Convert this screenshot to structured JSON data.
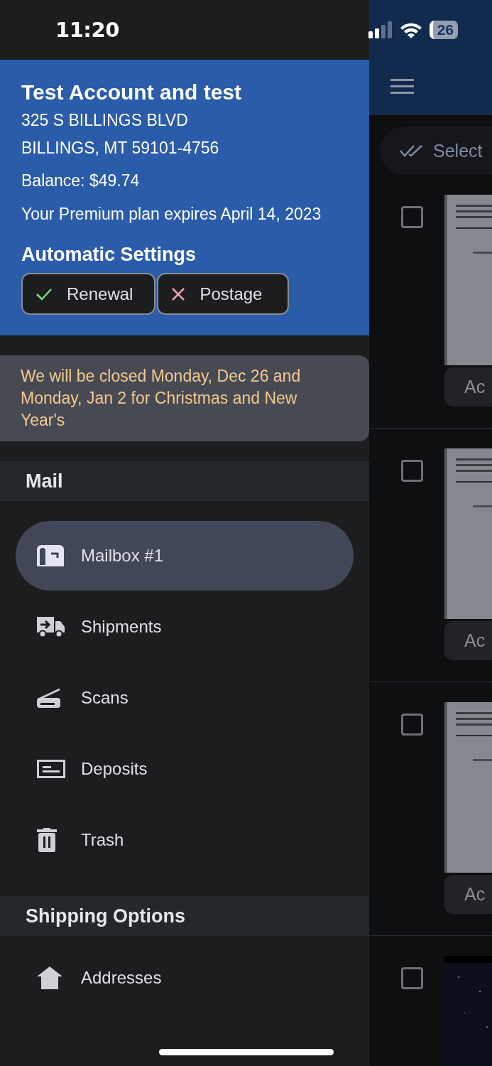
{
  "status_bar": {
    "time": "11:20",
    "battery": "26"
  },
  "drawer": {
    "account": {
      "name": "Test Account and test",
      "address_lines": [
        "325 S BILLINGS BLVD",
        "BILLINGS, MT 59101-4756"
      ],
      "balance": "Balance: $49.74",
      "plan": "Your Premium plan expires April 14, 2023"
    },
    "automatic_settings": {
      "title": "Automatic Settings",
      "toggles": [
        {
          "label": "Renewal",
          "on": true
        },
        {
          "label": "Postage",
          "on": false
        }
      ]
    },
    "notice": "We will be closed Monday, Dec 26 and Monday, Jan 2 for Christmas and New Year's",
    "sections": [
      {
        "title": "Mail",
        "items": [
          {
            "label": "Mailbox #1",
            "kind": "mailbox",
            "selected": true
          },
          {
            "label": "Shipments",
            "kind": "truck",
            "selected": false
          },
          {
            "label": "Scans",
            "kind": "scanner",
            "selected": false
          },
          {
            "label": "Deposits",
            "kind": "check",
            "selected": false
          },
          {
            "label": "Trash",
            "kind": "trash",
            "selected": false
          }
        ]
      },
      {
        "title": "Shipping Options",
        "items": [
          {
            "label": "Addresses",
            "kind": "home",
            "selected": false
          }
        ]
      }
    ]
  },
  "main": {
    "select_button": "Select",
    "rows": [
      {
        "checked": false,
        "action": "Ac"
      },
      {
        "checked": false,
        "action": "Ac"
      },
      {
        "checked": false,
        "action": "Ac"
      },
      {
        "checked": false
      }
    ]
  }
}
